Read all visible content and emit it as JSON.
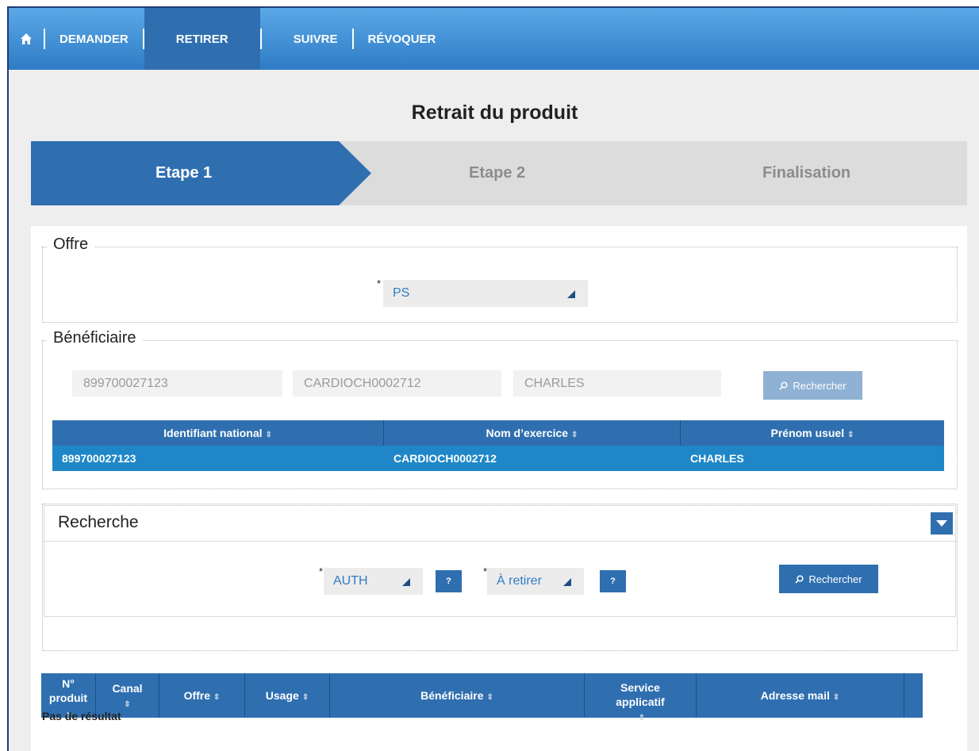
{
  "nav": {
    "home_icon": "home-icon",
    "items": [
      "DEMANDER",
      "RETIRER",
      "SUIVRE",
      "RÉVOQUER"
    ],
    "active": "RETIRER"
  },
  "page_title": "Retrait du produit",
  "steps": [
    "Etape 1",
    "Etape 2",
    "Finalisation"
  ],
  "offre": {
    "legend": "Offre",
    "required_mark": "*",
    "value": "PS"
  },
  "beneficiaire": {
    "legend": "Bénéficiaire",
    "id_value": "899700027123",
    "nom_value": "CARDIOCH0002712",
    "prenom_value": "CHARLES",
    "search_label": "Rechercher",
    "table": {
      "headers": [
        "Identifiant national",
        "Nom d’exercice",
        "Prénom usuel"
      ],
      "row": [
        "899700027123",
        "CARDIOCH0002712",
        "CHARLES"
      ]
    }
  },
  "recherche": {
    "title": "Recherche",
    "type_value": "AUTH",
    "status_value": "À retirer",
    "help_label": "?",
    "required_mark": "*",
    "search_label": "Rechercher"
  },
  "results": {
    "headers": [
      "N° produit",
      "Canal",
      "Offre",
      "Usage",
      "Bénéficiaire",
      "Service applicatif",
      "Adresse mail"
    ],
    "empty": "Pas de résultat"
  },
  "colors": {
    "nav_blue": "#2f7cc6",
    "active_blue": "#2f6fb0",
    "row_blue": "#1f87c8"
  }
}
